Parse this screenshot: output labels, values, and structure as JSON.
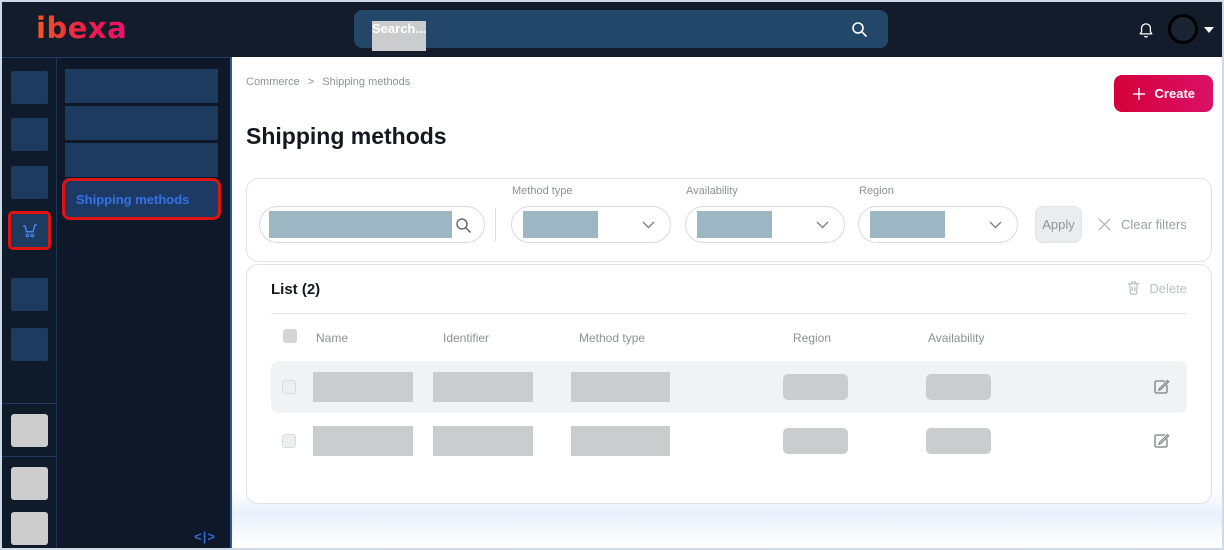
{
  "topbar": {
    "logo_text": "ibexa",
    "search_placeholder": "Search..."
  },
  "sidebar": {
    "active_item": "Shipping methods",
    "collapse_glyph": "<|>"
  },
  "breadcrumb": {
    "items": [
      "Commerce",
      "Shipping methods"
    ],
    "separator": ">"
  },
  "page": {
    "title": "Shipping methods"
  },
  "actions": {
    "create": "Create",
    "apply": "Apply",
    "clear_filters": "Clear filters",
    "delete": "Delete"
  },
  "filters": [
    {
      "label": "Method type"
    },
    {
      "label": "Availability"
    },
    {
      "label": "Region"
    }
  ],
  "list": {
    "title": "List (2)",
    "columns": [
      "Name",
      "Identifier",
      "Method type",
      "Region",
      "Availability"
    ],
    "row_count": 2
  },
  "colors": {
    "annotation_red": "#e01313",
    "redaction_blue_gray": "#9db6c4",
    "create_gradient": [
      "#d50039",
      "#da1168"
    ],
    "active_link_blue": "#3572e8"
  }
}
